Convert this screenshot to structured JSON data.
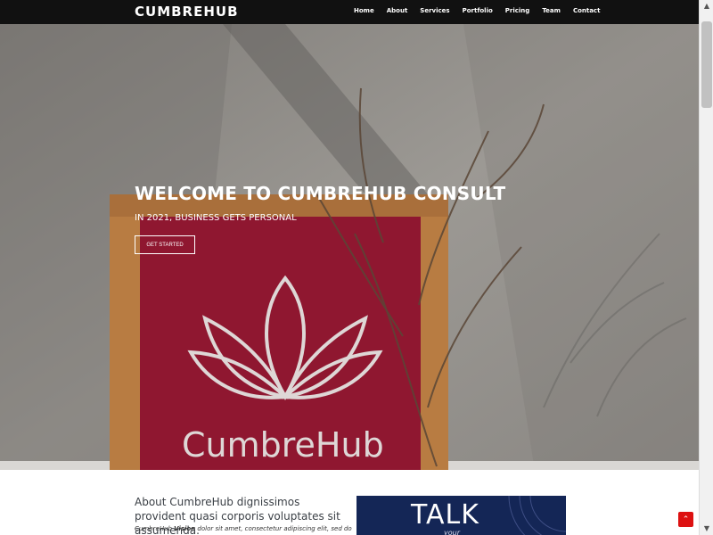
{
  "header": {
    "brand": "CUMBREHUB",
    "nav": [
      "Home",
      "About",
      "Services",
      "Portfolio",
      "Pricing",
      "Team",
      "Contact"
    ]
  },
  "hero": {
    "title": "WELCOME TO CUMBREHUB CONSULT",
    "subtitle": "IN 2021, BUSINESS GETS PERSONAL",
    "cta": "GET STARTED",
    "sign_text": "CumbreHub"
  },
  "about": {
    "heading": "About CumbreHub dignissimos provident quasi corporis voluptates sit assumenda.",
    "intro_prefix": "CumbreHub ",
    "intro_bold": "Vision",
    "intro_rest": " dolor sit amet, consectetur adipiscing elit, sed do",
    "card_text": "TALK",
    "card_subtext": "your"
  },
  "colors": {
    "header_bg": "#111111",
    "sign_red": "#8f1730",
    "card_blue": "#142656",
    "back_to_top": "#dd1111"
  },
  "icons": {
    "back_to_top": "chevron-up-icon",
    "scroll_up": "triangle-up-icon",
    "scroll_down": "triangle-down-icon"
  }
}
